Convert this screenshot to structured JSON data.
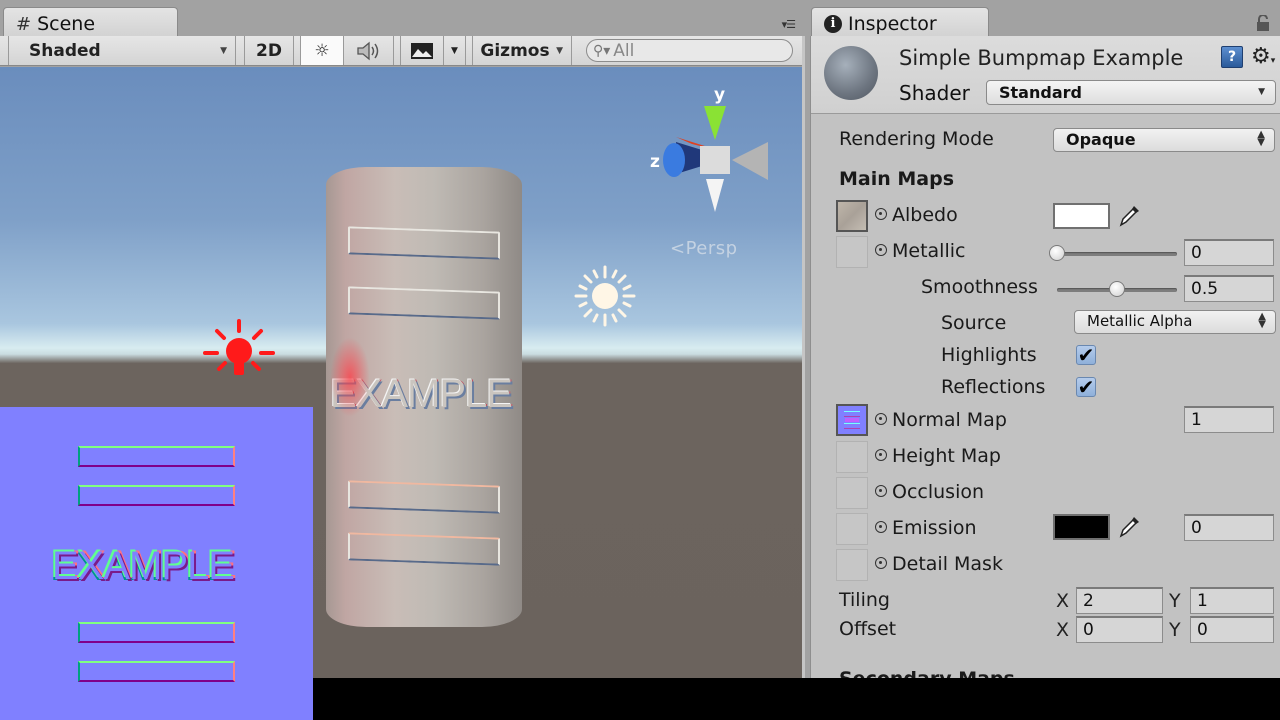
{
  "scene": {
    "tab_label": "Scene",
    "tab_icon": "grid-hash-icon",
    "toolbar": {
      "draw_mode": "Shaded",
      "mode_2d": "2D",
      "lighting_toggle_icon": "sun-icon",
      "audio_toggle_icon": "speaker-icon",
      "effects_toggle_icon": "image-icon",
      "gizmos_label": "Gizmos",
      "search_placeholder": "All"
    },
    "viewport": {
      "projection_label": "Persp",
      "gizmo_axes": {
        "y": "y",
        "z": "z"
      },
      "object_text": "EXAMPLE",
      "colors": {
        "point_light": "#ff1a1a",
        "directional_light": "#fff6e6",
        "axis_y": "#8ae234",
        "axis_z": "#3a7be0",
        "axis_x": "#e04020"
      }
    },
    "normal_map_overlay": {
      "text": "EXAMPLE",
      "bar_count": 4,
      "background": "#8080ff"
    }
  },
  "inspector": {
    "tab_label": "Inspector",
    "tab_icon": "info-icon",
    "material": {
      "name": "Simple Bumpmap Example",
      "shader_label": "Shader",
      "shader_value": "Standard"
    },
    "rendering_mode": {
      "label": "Rendering Mode",
      "value": "Opaque"
    },
    "main_maps": {
      "header": "Main Maps",
      "albedo": {
        "label": "Albedo",
        "color": "#ffffff"
      },
      "metallic": {
        "label": "Metallic",
        "value": "0",
        "slider_fraction": 0.0
      },
      "smoothness": {
        "label": "Smoothness",
        "value": "0.5",
        "slider_fraction": 0.5
      },
      "source": {
        "label": "Source",
        "value": "Metallic Alpha"
      },
      "highlights": {
        "label": "Highlights",
        "checked": true
      },
      "reflections": {
        "label": "Reflections",
        "checked": true
      },
      "normal_map": {
        "label": "Normal Map",
        "value": "1"
      },
      "height_map": {
        "label": "Height Map"
      },
      "occlusion": {
        "label": "Occlusion"
      },
      "emission": {
        "label": "Emission",
        "color": "#000000",
        "value": "0"
      },
      "detail_mask": {
        "label": "Detail Mask"
      },
      "tiling": {
        "label": "Tiling",
        "x_label": "X",
        "x": "2",
        "y_label": "Y",
        "y": "1"
      },
      "offset": {
        "label": "Offset",
        "x_label": "X",
        "x": "0",
        "y_label": "Y",
        "y": "0"
      }
    },
    "secondary_maps_header": "Secondary Maps"
  }
}
